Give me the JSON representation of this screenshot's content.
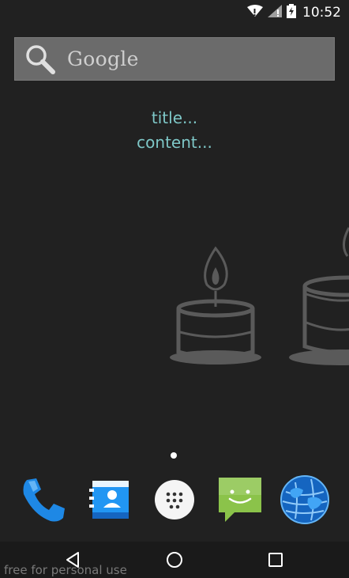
{
  "status_bar": {
    "time": "10:52",
    "icons": [
      "wifi-icon",
      "signal-icon",
      "battery-charging-icon"
    ]
  },
  "search": {
    "label": "Google",
    "icon": "search-icon"
  },
  "widget": {
    "title": "title...",
    "content": "content..."
  },
  "dock": {
    "items": [
      {
        "name": "phone",
        "icon": "phone-icon"
      },
      {
        "name": "contacts",
        "icon": "contacts-icon"
      },
      {
        "name": "app-drawer",
        "icon": "app-drawer-icon"
      },
      {
        "name": "messaging",
        "icon": "messaging-icon"
      },
      {
        "name": "browser",
        "icon": "globe-icon"
      }
    ]
  },
  "nav": {
    "icons": [
      "back-icon",
      "home-icon",
      "recents-icon"
    ]
  },
  "watermark": "free for personal use",
  "colors": {
    "background": "#212121",
    "widget_text": "#7ec7c7",
    "search_bg": "#6b6b6b"
  }
}
